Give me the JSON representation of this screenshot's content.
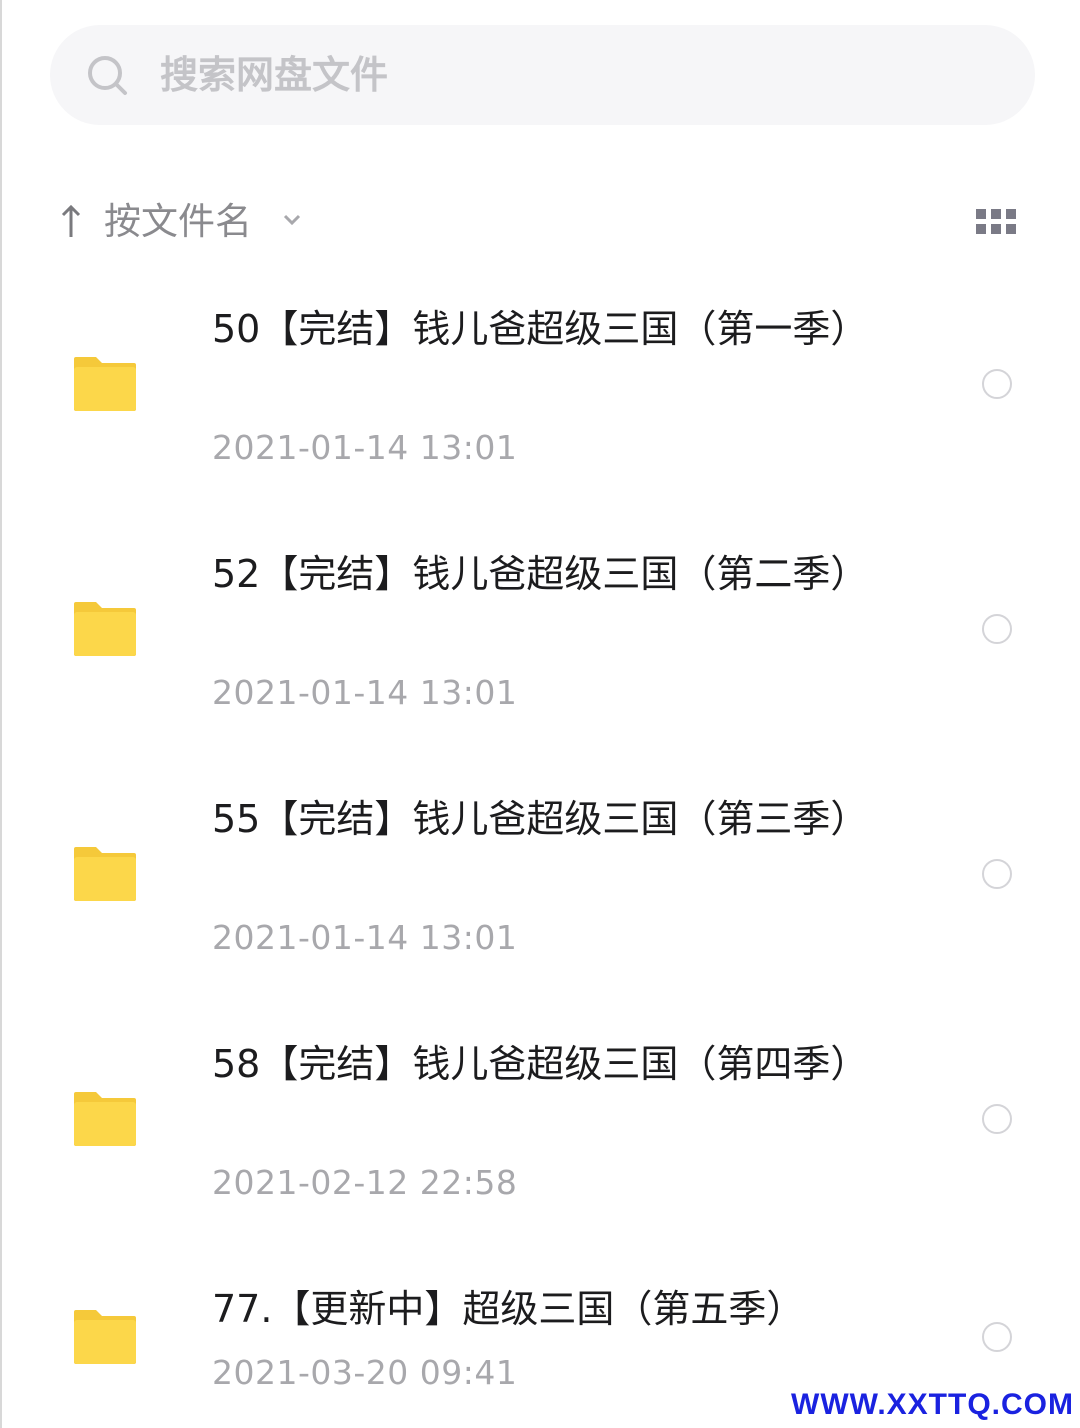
{
  "search": {
    "placeholder": "搜索网盘文件"
  },
  "sort": {
    "label": "按文件名"
  },
  "files": [
    {
      "name": "50【完结】钱儿爸超级三国（第一季）",
      "date": "2021-01-14  13:01"
    },
    {
      "name": "52【完结】钱儿爸超级三国（第二季）",
      "date": "2021-01-14  13:01"
    },
    {
      "name": "55【完结】钱儿爸超级三国（第三季）",
      "date": "2021-01-14  13:01"
    },
    {
      "name": "58【完结】钱儿爸超级三国（第四季）",
      "date": "2021-02-12  22:58"
    },
    {
      "name": "77.【更新中】超级三国（第五季）",
      "date": "2021-03-20  09:41"
    }
  ],
  "watermark": "WWW.XXTTQ.COM",
  "colors": {
    "folder": "#fcd74a",
    "folder_tab": "#f5c93a",
    "watermark": "#1a22e0"
  },
  "icons": {
    "search": "search-icon",
    "sort": "arrow-up-icon",
    "dropdown": "chevron-down-icon",
    "view": "grid-view-icon",
    "file": "folder-icon"
  }
}
